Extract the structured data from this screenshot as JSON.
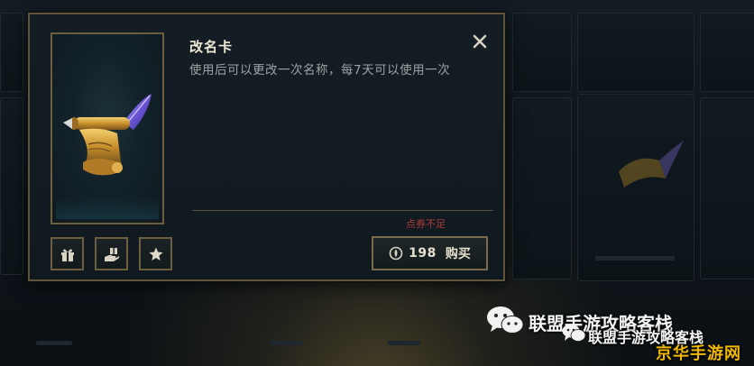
{
  "dialog": {
    "title": "改名卡",
    "description": "使用后可以更改一次名称，每7天可以使用一次",
    "close_icon": "close-icon",
    "warning": "点券不足",
    "buy_button": {
      "price": "198",
      "label": "购买",
      "currency_icon": "riot-points-icon"
    },
    "action_icons": [
      "gift-icon",
      "present-hand-icon",
      "star-icon"
    ]
  },
  "watermark": {
    "line1": "联盟手游攻略客栈",
    "line2": "联盟手游攻略客栈",
    "site": "京华手游网"
  },
  "colors": {
    "gold_border": "#6b5f3f",
    "title": "#efe9d6",
    "warning": "#b13a3a",
    "site_watermark": "#f0b800"
  }
}
